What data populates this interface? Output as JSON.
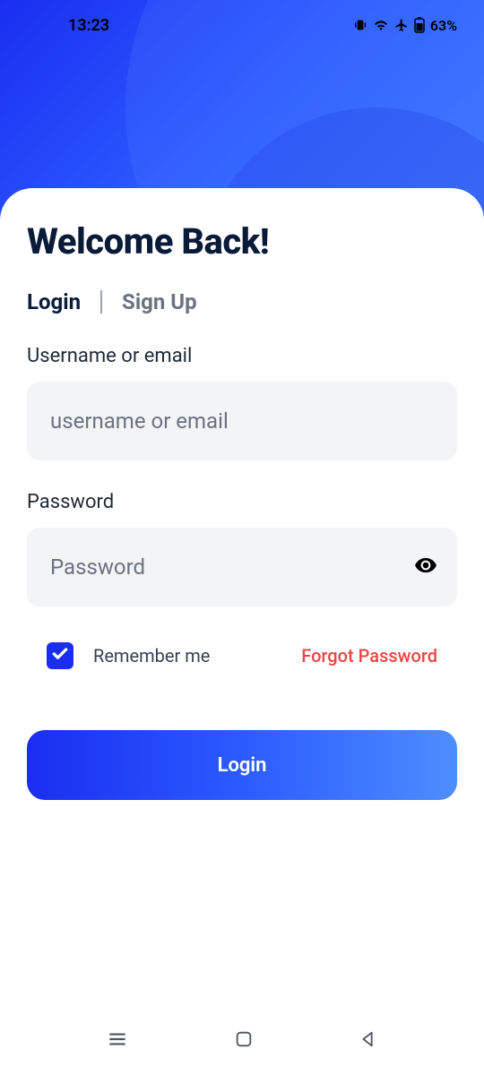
{
  "status": {
    "time": "13:23",
    "battery": "63%"
  },
  "title": "Welcome Back!",
  "tabs": {
    "login": "Login",
    "signup": "Sign Up"
  },
  "fields": {
    "username_label": "Username or email",
    "username_placeholder": "username or email",
    "password_label": "Password",
    "password_placeholder": "Password"
  },
  "options": {
    "remember_label": "Remember me",
    "remember_checked": true,
    "forgot_label": "Forgot Password"
  },
  "buttons": {
    "login": "Login"
  }
}
